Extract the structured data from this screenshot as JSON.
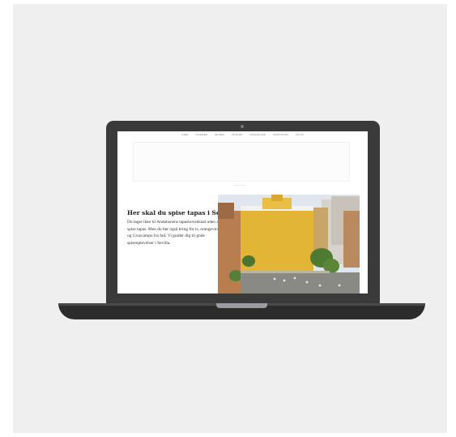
{
  "nav": {
    "items": [
      "HJEM",
      "NYHEDER",
      "REJSER",
      "AFTALER",
      "OPLEVELSER",
      "PRODUKTER",
      "OM OS"
    ]
  },
  "article": {
    "heading": "Her skal du spise tapas i Sevilla",
    "body": "Du tager ikke til Andalusiens tapashovedstad uden at spise tapas. Men du bør også bring for is, orangevin og Cruzcampo fra fad. Vi guider dig til gode spiseoplevelser i Sevilla."
  },
  "colors": {
    "device_body": "#3a3a3b",
    "backdrop": "#efeff0",
    "building_facade": "#e2b537"
  },
  "icons": [
    "camera-icon"
  ]
}
